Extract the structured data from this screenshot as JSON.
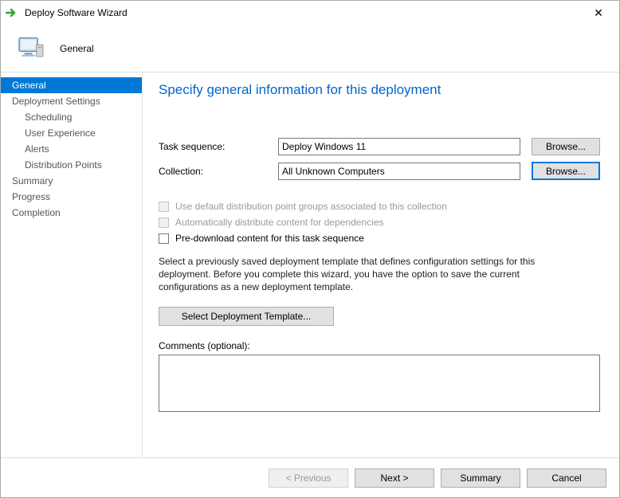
{
  "window": {
    "title": "Deploy Software Wizard",
    "close_label": "✕"
  },
  "header": {
    "page_name": "General"
  },
  "sidebar": {
    "items": [
      {
        "label": "General",
        "active": true,
        "indent": false
      },
      {
        "label": "Deployment Settings",
        "active": false,
        "indent": false
      },
      {
        "label": "Scheduling",
        "active": false,
        "indent": true
      },
      {
        "label": "User Experience",
        "active": false,
        "indent": true
      },
      {
        "label": "Alerts",
        "active": false,
        "indent": true
      },
      {
        "label": "Distribution Points",
        "active": false,
        "indent": true
      },
      {
        "label": "Summary",
        "active": false,
        "indent": false
      },
      {
        "label": "Progress",
        "active": false,
        "indent": false
      },
      {
        "label": "Completion",
        "active": false,
        "indent": false
      }
    ]
  },
  "main": {
    "heading": "Specify general information for this deployment",
    "task_sequence_label": "Task sequence:",
    "task_sequence_value": "Deploy Windows 11",
    "collection_label": "Collection:",
    "collection_value": "All Unknown Computers",
    "browse_label": "Browse...",
    "cb_default_dp": "Use default distribution point groups associated to this collection",
    "cb_auto_distribute": "Automatically distribute content for dependencies",
    "cb_predownload": "Pre-download content for this task sequence",
    "help_text": "Select a previously saved deployment template that defines configuration settings for this deployment. Before you complete this wizard, you have the option to save the current configurations as a new deployment template.",
    "select_template_label": "Select Deployment Template...",
    "comments_label": "Comments (optional):",
    "comments_value": ""
  },
  "footer": {
    "previous": "< Previous",
    "next": "Next >",
    "summary": "Summary",
    "cancel": "Cancel"
  }
}
